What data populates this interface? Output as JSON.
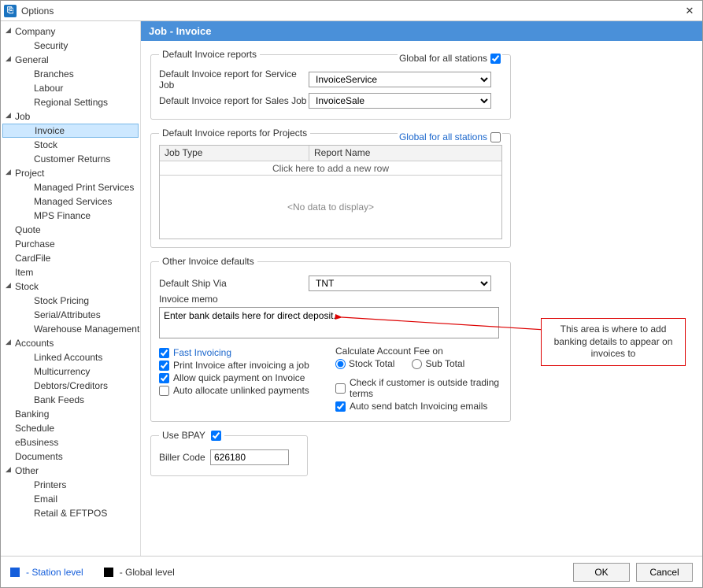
{
  "window": {
    "title": "Options"
  },
  "tree": {
    "company": "Company",
    "security": "Security",
    "general": "General",
    "branches": "Branches",
    "labour": "Labour",
    "regional": "Regional Settings",
    "job": "Job",
    "invoice": "Invoice",
    "stock": "Stock",
    "customerreturns": "Customer Returns",
    "project": "Project",
    "managedprint": "Managed Print Services",
    "managedservices": "Managed Services",
    "mpsfinance": "MPS Finance",
    "quote": "Quote",
    "purchase": "Purchase",
    "cardfile": "CardFile",
    "item": "Item",
    "stock2": "Stock",
    "stockpricing": "Stock Pricing",
    "serial": "Serial/Attributes",
    "warehouse": "Warehouse Management",
    "accounts": "Accounts",
    "linked": "Linked Accounts",
    "multicurrency": "Multicurrency",
    "debtors": "Debtors/Creditors",
    "bankfeeds": "Bank Feeds",
    "banking": "Banking",
    "schedule": "Schedule",
    "ebusiness": "eBusiness",
    "documents": "Documents",
    "other": "Other",
    "printers": "Printers",
    "email": "Email",
    "retail": "Retail & EFTPOS"
  },
  "header": {
    "title": "Job - Invoice"
  },
  "group1": {
    "legend": "Default Invoice reports",
    "global_label": "Global for all stations",
    "row1_label": "Default Invoice report for Service Job",
    "row1_value": "InvoiceService",
    "row2_label": "Default Invoice report for Sales Job",
    "row2_value": "InvoiceSale"
  },
  "group2": {
    "legend": "Default Invoice reports for Projects",
    "global_label": "Global for all stations",
    "col1": "Job Type",
    "col2": "Report Name",
    "addrow": "Click here to add a new row",
    "nodata": "<No data to display>"
  },
  "group3": {
    "legend": "Other Invoice defaults",
    "shipvia_label": "Default Ship Via",
    "shipvia_value": "TNT",
    "memo_label": "Invoice memo",
    "memo_value": "Enter bank details here for direct deposit.",
    "fast_invoicing": "Fast Invoicing",
    "print_after": "Print Invoice after invoicing a job",
    "allow_quick": "Allow quick payment on Invoice",
    "auto_allocate": "Auto allocate unlinked payments",
    "calc_fee_label": "Calculate Account Fee on",
    "stock_total": "Stock Total",
    "sub_total": "Sub Total",
    "check_outside": "Check if customer is outside trading terms",
    "auto_send": "Auto send batch Invoicing emails"
  },
  "group4": {
    "legend": "Use BPAY",
    "biller_label": "Biller Code",
    "biller_value": "626180"
  },
  "callout": {
    "text": "This area is where to add banking details to appear on invoices to"
  },
  "footer": {
    "station_level": " - Station level",
    "global_level": " - Global level",
    "ok": "OK",
    "cancel": "Cancel"
  }
}
